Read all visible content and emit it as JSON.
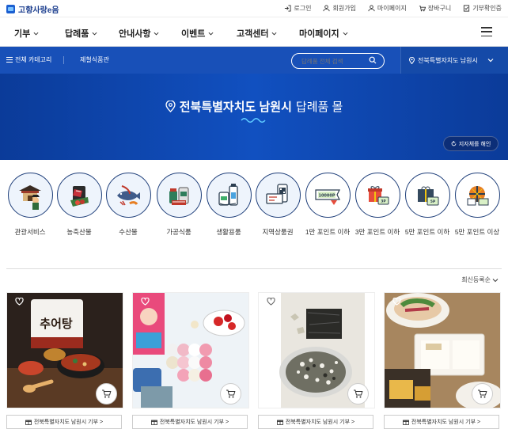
{
  "brand": {
    "name": "고향사랑e음",
    "color": "#1d3f8f"
  },
  "utility": [
    {
      "icon": "login-icon",
      "label": "로그인"
    },
    {
      "icon": "person-icon",
      "label": "회원가입"
    },
    {
      "icon": "person-icon",
      "label": "마이페이지"
    },
    {
      "icon": "cart-icon",
      "label": "장바구니"
    },
    {
      "icon": "document-check-icon",
      "label": "기부확인증"
    }
  ],
  "main_nav": [
    "기부",
    "답례품",
    "안내사항",
    "이벤트",
    "고객센터",
    "마이페이지"
  ],
  "category_bar": {
    "all_label": "전체 카테고리",
    "sub_label": "제철식품관",
    "search_placeholder": "답례품 전체 검색",
    "region_label": "전북특별자치도 남원시",
    "color": "#1850b8"
  },
  "hero": {
    "title_bold": "전북특별자치도 남원시",
    "title_normal": "답례품 몰",
    "button_label": "지자체를 해인"
  },
  "categories": [
    {
      "icon": "tourism-icon",
      "label": "관광서비스"
    },
    {
      "icon": "meat-icon",
      "label": "농축산물"
    },
    {
      "icon": "fish-icon",
      "label": "수산물"
    },
    {
      "icon": "processed-food-icon",
      "label": "가공식품"
    },
    {
      "icon": "daily-goods-icon",
      "label": "생활용품"
    },
    {
      "icon": "local-voucher-icon",
      "label": "지역상품권"
    },
    {
      "icon": "ticket-10000-icon",
      "label": "1만 포인트 이하"
    },
    {
      "icon": "gift-icon",
      "label": "3만 포인트 이하"
    },
    {
      "icon": "gift-box-icon",
      "label": "5만 포인트 이하"
    },
    {
      "icon": "present-icon",
      "label": "5만 포인트 이상"
    }
  ],
  "sort_label": "최신등록순",
  "products": [
    {
      "name": "chueotang",
      "image_text": "추어탕",
      "donate_label": "전북특별자치도 남원시 기부 >"
    },
    {
      "name": "rice-cake",
      "image_text": "",
      "donate_label": "전북특별자치도 남원시 기부 >"
    },
    {
      "name": "seaweed-snack",
      "image_text": "",
      "donate_label": "전북특별자치도 남원시 기부 >"
    },
    {
      "name": "tofu-set",
      "image_text": "",
      "donate_label": "전북특별자치도 남원시 기부 >"
    }
  ]
}
